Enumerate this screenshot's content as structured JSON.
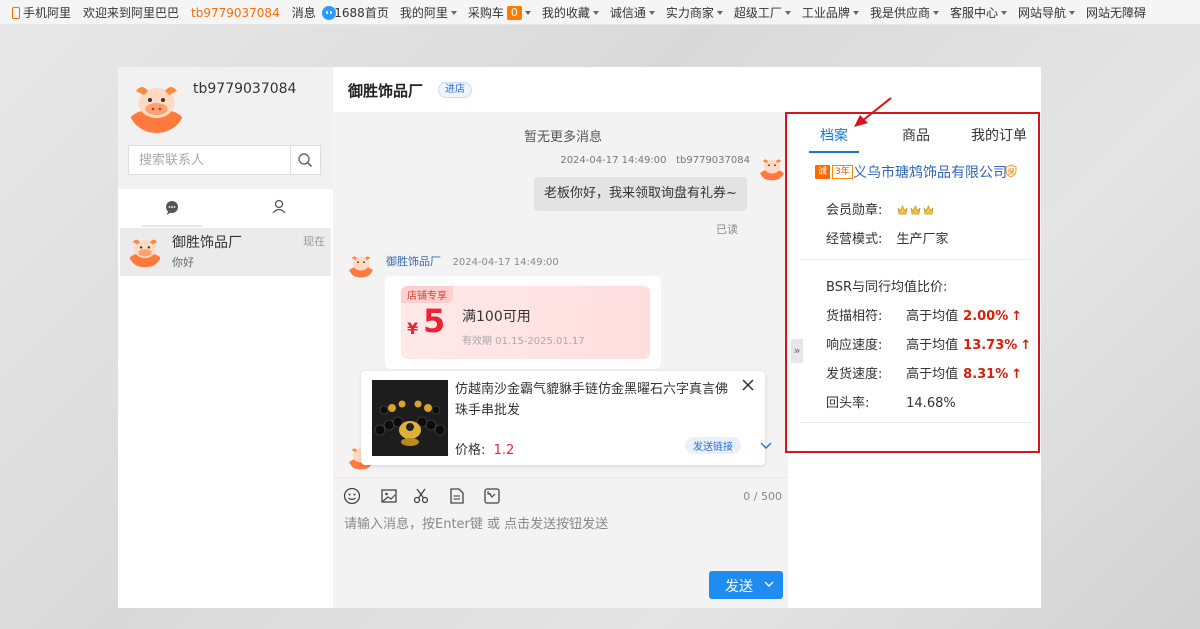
{
  "topbar": {
    "left": {
      "mobile": "手机阿里",
      "welcome": "欢迎来到阿里巴巴",
      "user": "tb9779037084",
      "messages": "消息"
    },
    "right": [
      {
        "label": "1688首页",
        "dropdown": false
      },
      {
        "label": "我的阿里",
        "dropdown": true
      },
      {
        "label": "采购车",
        "dropdown": true,
        "badge": "0"
      },
      {
        "label": "我的收藏",
        "dropdown": true
      },
      {
        "label": "诚信通",
        "dropdown": true
      },
      {
        "label": "实力商家",
        "dropdown": true
      },
      {
        "label": "超级工厂",
        "dropdown": true
      },
      {
        "label": "工业品牌",
        "dropdown": true
      },
      {
        "label": "我是供应商",
        "dropdown": true
      },
      {
        "label": "客服中心",
        "dropdown": true
      },
      {
        "label": "网站导航",
        "dropdown": true
      },
      {
        "label": "网站无障碍",
        "dropdown": false
      }
    ]
  },
  "sidebar": {
    "username": "tb9779037084",
    "search_placeholder": "搜索联系人",
    "contacts": [
      {
        "name": "御胜饰品厂",
        "preview": "你好",
        "time": "现在"
      }
    ]
  },
  "chat": {
    "shop_name": "御胜饰品厂",
    "enter_shop": "进店",
    "no_more": "暂无更多消息",
    "messages": {
      "outgoing": {
        "time": "2024-04-17 14:49:00",
        "sender": "tb9779037084",
        "text": "老板你好，我来领取询盘有礼券~",
        "status": "已读"
      },
      "incoming": {
        "sender": "御胜饰品厂",
        "time": "2024-04-17 14:49:00"
      }
    },
    "coupon": {
      "tag": "店铺专享",
      "currency": "¥",
      "amount": "5",
      "condition": "满100可用",
      "validity": "有效期 01.15-2025.01.17"
    },
    "product": {
      "title": "仿越南沙金霸气貔貅手链仿金黑曜石六字真言佛珠手串批发",
      "price_label": "价格:",
      "price": "1.2",
      "send_link": "发送链接"
    },
    "counter": "0 / 500",
    "input_placeholder": "请输入消息，按Enter键 或 点击发送按钮发送",
    "send_label": "发送"
  },
  "right_panel": {
    "tabs": [
      "档案",
      "商品",
      "我的订单"
    ],
    "active_tab": "档案",
    "company_badge": "诚",
    "company_years": "3年",
    "company_name": "义乌市瑭鸩饰品有限公司",
    "member_label": "会员勋章:",
    "business_label": "经营模式:",
    "business_value": "生产厂家",
    "bsr_title": "BSR与同行均值比价:",
    "bsr": [
      {
        "label": "货描相符:",
        "compare": "高于均值",
        "value": "2.00%",
        "arrow": "↑"
      },
      {
        "label": "响应速度:",
        "compare": "高于均值",
        "value": "13.73%",
        "arrow": "↑"
      },
      {
        "label": "发货速度:",
        "compare": "高于均值",
        "value": "8.31%",
        "arrow": "↑"
      },
      {
        "label": "回头率:",
        "compare": "14.68%",
        "value": "",
        "arrow": ""
      }
    ]
  },
  "colors": {
    "accent_orange": "#ff6a00",
    "link_blue": "#1677d9",
    "send_blue": "#1e8cf0",
    "highlight_red": "#d7141c"
  }
}
